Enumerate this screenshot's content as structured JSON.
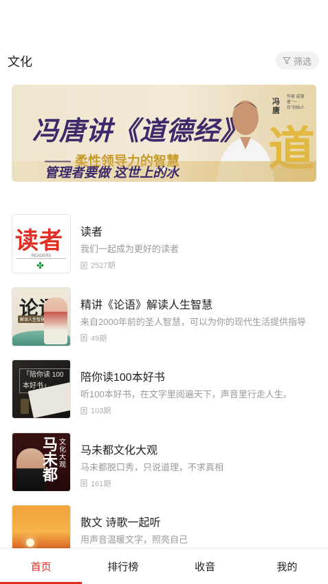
{
  "header": {
    "title": "文化",
    "filter_label": "筛选",
    "filter_icon": "filter-icon"
  },
  "banner": {
    "title": "冯唐讲《道德经》",
    "subtitle": "柔性领导力的智慧",
    "tagline": "管理者要做 这世上的水",
    "name": "冯唐",
    "role": "作家 成事者 “一日”创始人",
    "decor_char": "道"
  },
  "list": {
    "items": [
      {
        "title": "读者",
        "desc": "我们一起成为更好的读者",
        "count": "2527期",
        "thumb_text": "读者",
        "thumb_sub": "READERS"
      },
      {
        "title": "精讲《论语》解读人生智慧",
        "desc": "来自2000年前的圣人智慧，可以为你的现代生活提供指导",
        "count": "49期",
        "thumb_text": "论语",
        "thumb_sub": "解读人生智慧"
      },
      {
        "title": "陪你读100本好书",
        "desc": "听100本好书，在文字里阅遍天下，声音里行走人生。",
        "count": "103期",
        "thumb_text": "「陪你读 100本好书」"
      },
      {
        "title": "马未都文化大观",
        "desc": "马未都脱口秀，只说道理，不求真相",
        "count": "161期",
        "thumb_text": "马未都",
        "thumb_sub": "文化大观"
      },
      {
        "title": "散文 诗歌一起听",
        "desc": "用声音温暖文字，照亮自己",
        "count": ""
      }
    ]
  },
  "tabbar": {
    "tabs": [
      "首页",
      "排行榜",
      "收音",
      "我的"
    ],
    "active_color": "#e02b1f"
  }
}
